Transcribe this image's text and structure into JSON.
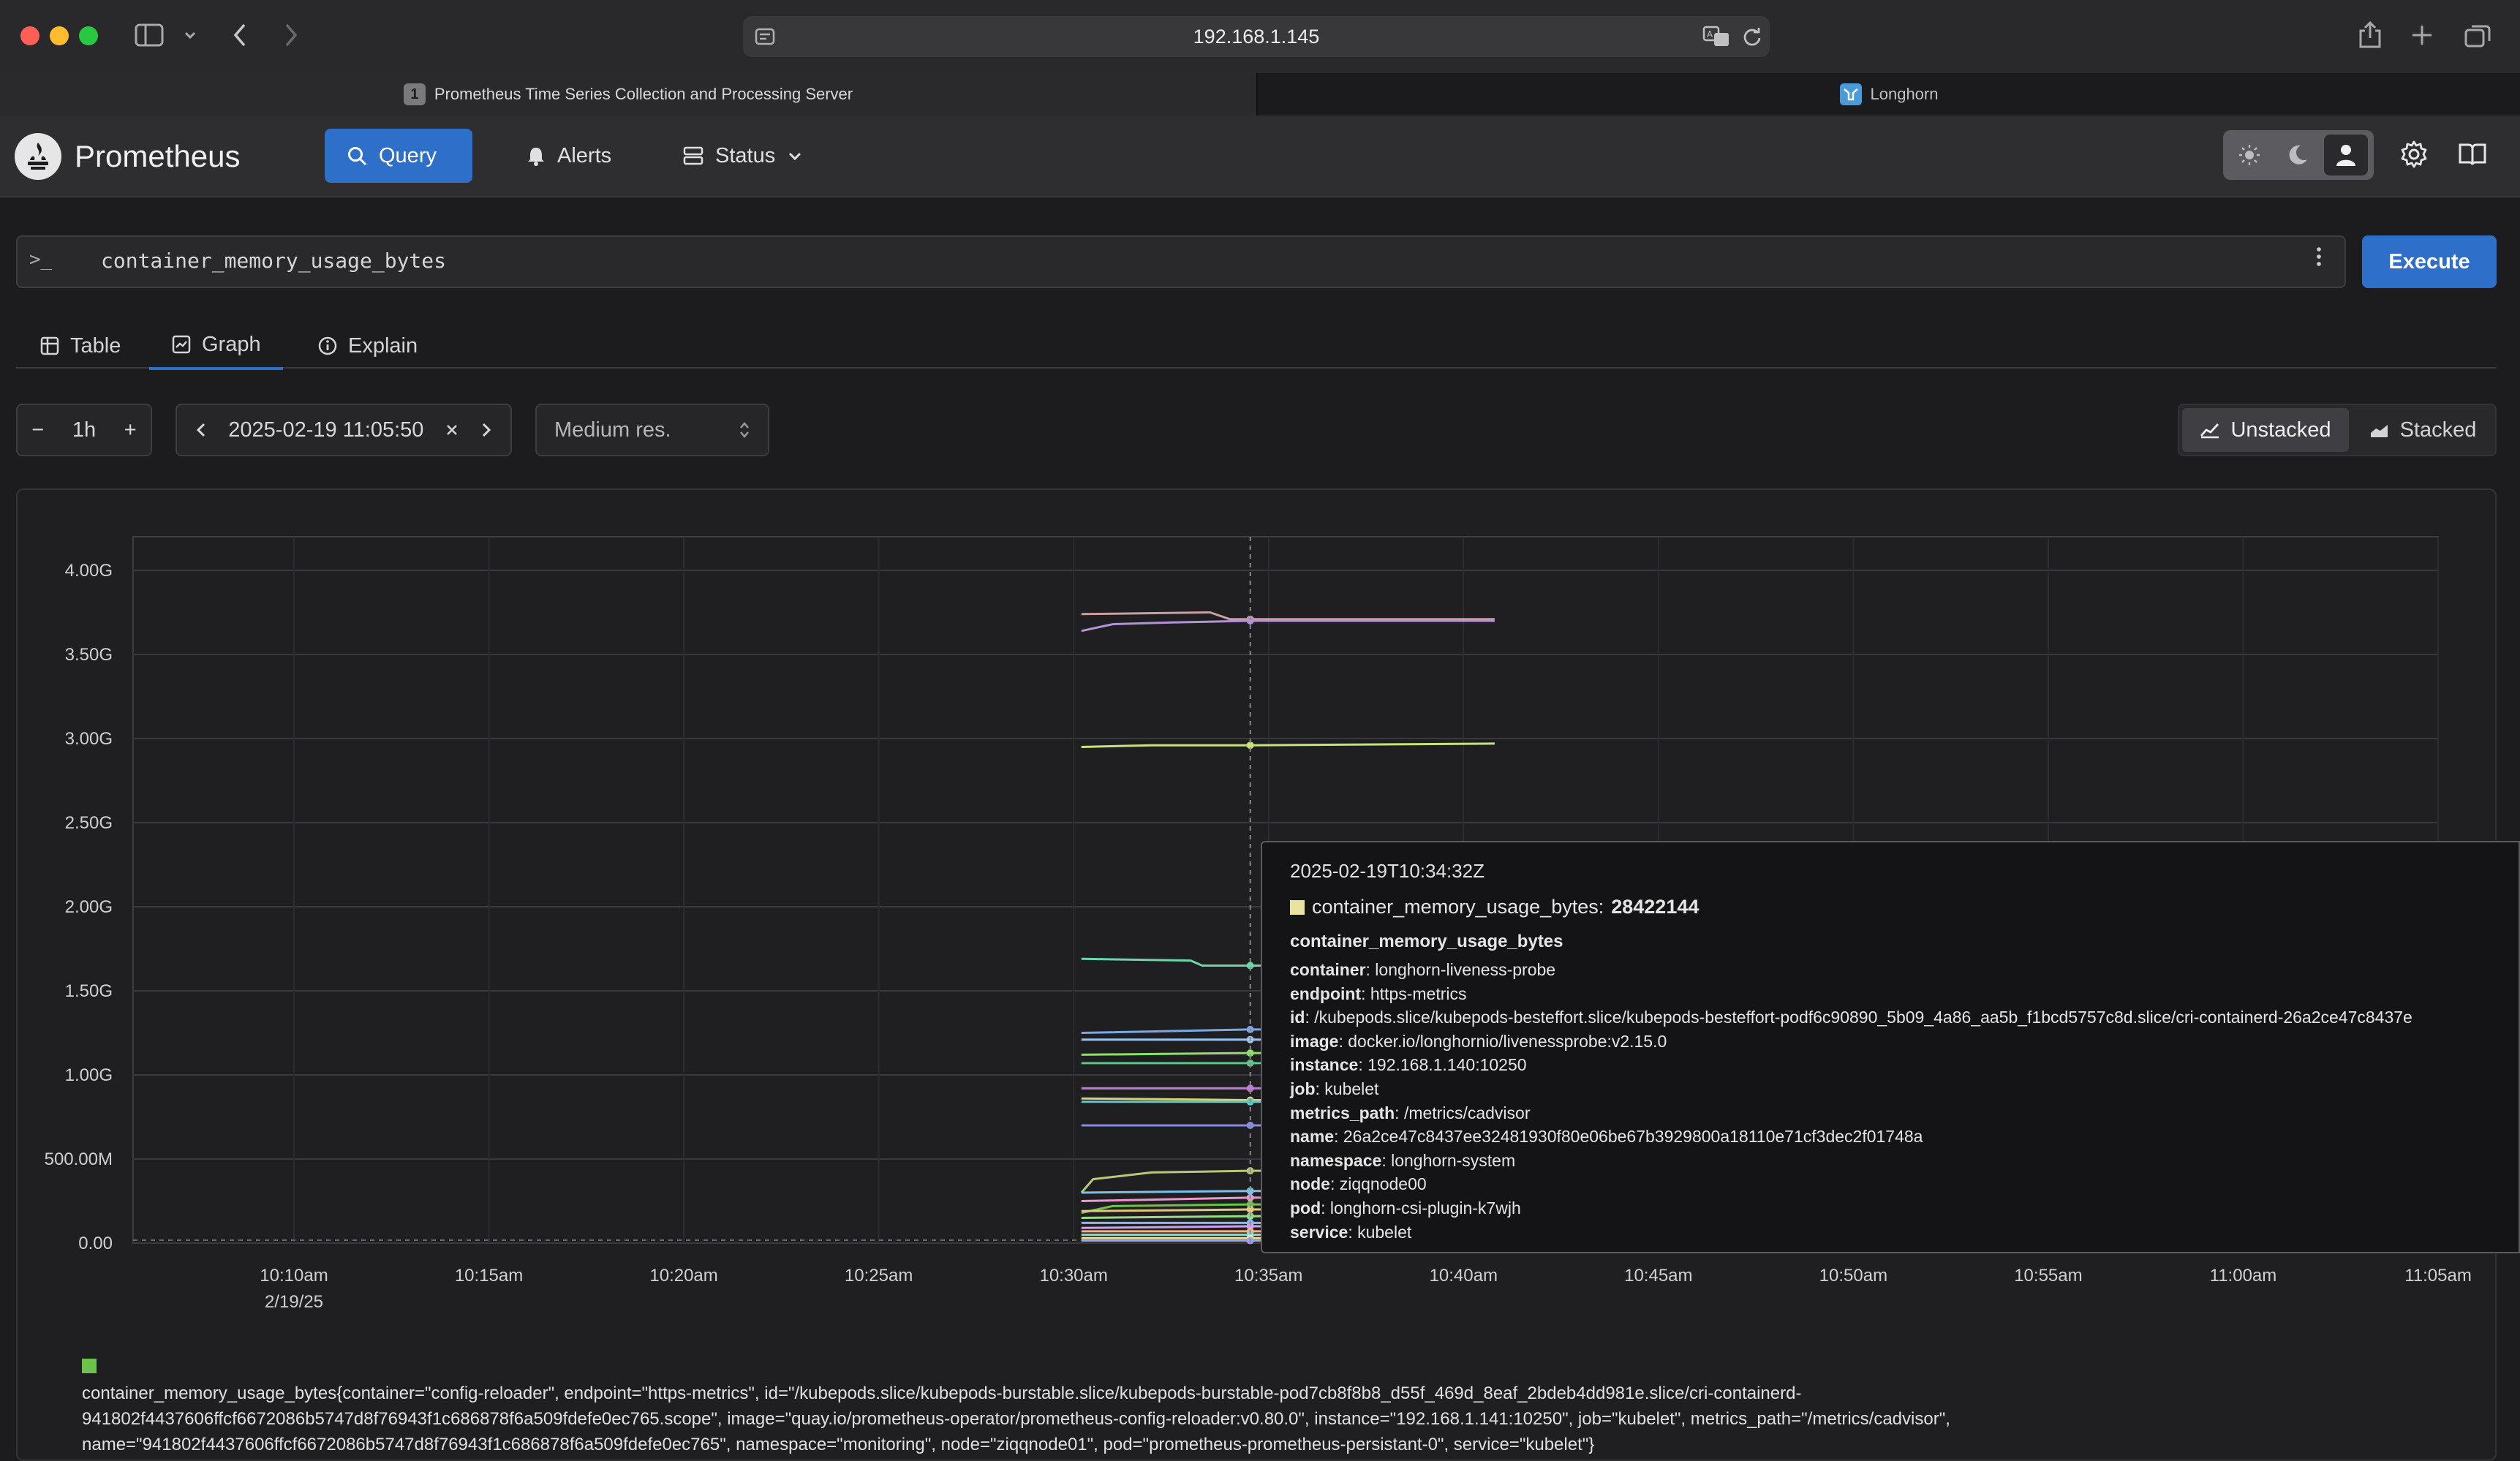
{
  "browser": {
    "url": "192.168.1.145",
    "tabs": [
      {
        "label": "Prometheus Time Series Collection and Processing Server",
        "badge": "1"
      },
      {
        "label": "Longhorn"
      }
    ]
  },
  "navbar": {
    "brand": "Prometheus",
    "items": [
      {
        "label": "Query",
        "icon": "search-icon",
        "active": true
      },
      {
        "label": "Alerts",
        "icon": "bell-icon"
      },
      {
        "label": "Status",
        "icon": "server-icon"
      }
    ],
    "theme_options": [
      "light",
      "dark",
      "auto"
    ],
    "accent": "#2e70c9"
  },
  "query": {
    "prompt": ">_",
    "expression": "container_memory_usage_bytes",
    "execute_label": "Execute"
  },
  "tabs": [
    {
      "label": "Table",
      "icon": "table-icon"
    },
    {
      "label": "Graph",
      "icon": "graph-icon",
      "active": true
    },
    {
      "label": "Explain",
      "icon": "info-icon"
    }
  ],
  "controls": {
    "range": "1h",
    "minus": "−",
    "plus": "+",
    "end_time": "2025-02-19 11:05:50",
    "resolution": "Medium res.",
    "unstacked_label": "Unstacked",
    "stacked_label": "Stacked"
  },
  "chart_data": {
    "type": "line",
    "ylim": [
      0,
      4.2
    ],
    "y_unit": "G",
    "y_ticks": [
      {
        "v": 0,
        "label": "0.00"
      },
      {
        "v": 0.5,
        "label": "500.00M"
      },
      {
        "v": 1.0,
        "label": "1.00G"
      },
      {
        "v": 1.5,
        "label": "1.50G"
      },
      {
        "v": 2.0,
        "label": "2.00G"
      },
      {
        "v": 2.5,
        "label": "2.50G"
      },
      {
        "v": 3.0,
        "label": "3.00G"
      },
      {
        "v": 3.5,
        "label": "3.50G"
      },
      {
        "v": 4.0,
        "label": "4.00G"
      }
    ],
    "x_range_min": [
      6.0,
      66.0
    ],
    "x_ticks": [
      {
        "m": 10,
        "label": "10:10am",
        "sub": "2/19/25"
      },
      {
        "m": 15,
        "label": "10:15am"
      },
      {
        "m": 20,
        "label": "10:20am"
      },
      {
        "m": 25,
        "label": "10:25am"
      },
      {
        "m": 30,
        "label": "10:30am"
      },
      {
        "m": 35,
        "label": "10:35am"
      },
      {
        "m": 40,
        "label": "10:40am"
      },
      {
        "m": 45,
        "label": "10:45am"
      },
      {
        "m": 50,
        "label": "10:50am"
      },
      {
        "m": 55,
        "label": "10:55am"
      },
      {
        "m": 60,
        "label": "11:00am"
      },
      {
        "m": 65,
        "label": "11:05am"
      }
    ],
    "hover_minute": 34.53,
    "series": [
      {
        "color": "#c9a0a0",
        "x": [
          30.2,
          33.5,
          34.0,
          34.5,
          40.8
        ],
        "y": [
          3.74,
          3.75,
          3.71,
          3.71,
          3.71
        ]
      },
      {
        "color": "#b592d6",
        "x": [
          30.2,
          31.0,
          32.5,
          34.5,
          40.8
        ],
        "y": [
          3.64,
          3.68,
          3.69,
          3.7,
          3.7
        ]
      },
      {
        "color": "#c6e27a",
        "x": [
          30.2,
          32.0,
          34.5,
          40.8
        ],
        "y": [
          2.95,
          2.96,
          2.96,
          2.97
        ]
      },
      {
        "color": "#6cd6a8",
        "x": [
          30.2,
          33.0,
          33.3,
          34.5,
          35.0
        ],
        "y": [
          1.69,
          1.68,
          1.65,
          1.65,
          1.65
        ]
      },
      {
        "color": "#7aa8e6",
        "x": [
          30.2,
          34.5,
          35.0
        ],
        "y": [
          1.25,
          1.27,
          1.27
        ]
      },
      {
        "color": "#a0c4f0",
        "x": [
          30.2,
          34.5,
          35.0
        ],
        "y": [
          1.21,
          1.21,
          1.21
        ]
      },
      {
        "color": "#8ee06a",
        "x": [
          30.2,
          34.5,
          35.0
        ],
        "y": [
          1.12,
          1.13,
          1.13
        ]
      },
      {
        "color": "#62c48a",
        "x": [
          30.2,
          34.5,
          35.0
        ],
        "y": [
          1.07,
          1.07,
          1.07
        ]
      },
      {
        "color": "#c27ad8",
        "x": [
          30.2,
          34.5,
          35.0
        ],
        "y": [
          0.92,
          0.92,
          0.92
        ]
      },
      {
        "color": "#d2d27a",
        "x": [
          30.2,
          34.5,
          35.0
        ],
        "y": [
          0.86,
          0.85,
          0.85
        ]
      },
      {
        "color": "#5ec8c8",
        "x": [
          30.2,
          34.5,
          35.0
        ],
        "y": [
          0.84,
          0.84,
          0.84
        ]
      },
      {
        "color": "#8a8ae8",
        "x": [
          30.2,
          34.5,
          35.0
        ],
        "y": [
          0.7,
          0.7,
          0.7
        ]
      },
      {
        "color": "#b8c87a",
        "x": [
          30.2,
          30.5,
          32.0,
          34.5,
          35.0
        ],
        "y": [
          0.3,
          0.38,
          0.42,
          0.43,
          0.43
        ]
      },
      {
        "color": "#7ac0e8",
        "x": [
          30.2,
          34.5,
          35.0
        ],
        "y": [
          0.3,
          0.31,
          0.31
        ]
      },
      {
        "color": "#e89ad0",
        "x": [
          30.2,
          34.5,
          35.0
        ],
        "y": [
          0.25,
          0.27,
          0.27
        ]
      },
      {
        "color": "#6cc24a",
        "x": [
          30.2,
          31.0,
          34.5,
          35.0
        ],
        "y": [
          0.18,
          0.22,
          0.23,
          0.23
        ]
      },
      {
        "color": "#e0c87a",
        "x": [
          30.2,
          34.5,
          35.0
        ],
        "y": [
          0.19,
          0.2,
          0.2
        ]
      },
      {
        "color": "#9ad88a",
        "x": [
          30.2,
          34.5,
          35.0
        ],
        "y": [
          0.15,
          0.16,
          0.16
        ]
      },
      {
        "color": "#8ab8f0",
        "x": [
          30.2,
          34.5,
          35.0
        ],
        "y": [
          0.12,
          0.12,
          0.12
        ]
      },
      {
        "color": "#d0a0f0",
        "x": [
          30.2,
          34.5,
          35.0
        ],
        "y": [
          0.09,
          0.1,
          0.1
        ]
      },
      {
        "color": "#f0b080",
        "x": [
          30.2,
          34.5,
          35.0
        ],
        "y": [
          0.07,
          0.07,
          0.07
        ]
      },
      {
        "color": "#80e0d0",
        "x": [
          30.2,
          34.5,
          35.0
        ],
        "y": [
          0.05,
          0.05,
          0.05
        ]
      },
      {
        "color": "#e8e4a0",
        "x": [
          30.2,
          34.5,
          35.0
        ],
        "y": [
          0.03,
          0.03,
          0.03
        ]
      },
      {
        "color": "#a0a0f0",
        "x": [
          30.2,
          34.5,
          35.0
        ],
        "y": [
          0.015,
          0.015,
          0.015
        ]
      }
    ]
  },
  "tooltip": {
    "timestamp": "2025-02-19T10:34:32Z",
    "metric_label": "container_memory_usage_bytes:",
    "value": "28422144",
    "swatch_color": "#e8e4a0",
    "metric_name": "container_memory_usage_bytes",
    "labels": [
      {
        "k": "container",
        "v": "longhorn-liveness-probe"
      },
      {
        "k": "endpoint",
        "v": "https-metrics"
      },
      {
        "k": "id",
        "v": "/kubepods.slice/kubepods-besteffort.slice/kubepods-besteffort-podf6c90890_5b09_4a86_aa5b_f1bcd5757c8d.slice/cri-containerd-26a2ce47c8437e"
      },
      {
        "k": "image",
        "v": "docker.io/longhornio/livenessprobe:v2.15.0"
      },
      {
        "k": "instance",
        "v": "192.168.1.140:10250"
      },
      {
        "k": "job",
        "v": "kubelet"
      },
      {
        "k": "metrics_path",
        "v": "/metrics/cadvisor"
      },
      {
        "k": "name",
        "v": "26a2ce47c8437ee32481930f80e06be67b3929800a18110e71cf3dec2f01748a"
      },
      {
        "k": "namespace",
        "v": "longhorn-system"
      },
      {
        "k": "node",
        "v": "ziqqnode00"
      },
      {
        "k": "pod",
        "v": "longhorn-csi-plugin-k7wjh"
      },
      {
        "k": "service",
        "v": "kubelet"
      }
    ]
  },
  "legend": {
    "swatch_color": "#6cc24a",
    "text": "container_memory_usage_bytes{container=\"config-reloader\", endpoint=\"https-metrics\", id=\"/kubepods.slice/kubepods-burstable.slice/kubepods-burstable-pod7cb8f8b8_d55f_469d_8eaf_2bdeb4dd981e.slice/cri-containerd-941802f4437606ffcf6672086b5747d8f76943f1c686878f6a509fdefe0ec765.scope\", image=\"quay.io/prometheus-operator/prometheus-config-reloader:v0.80.0\", instance=\"192.168.1.141:10250\", job=\"kubelet\", metrics_path=\"/metrics/cadvisor\", name=\"941802f4437606ffcf6672086b5747d8f76943f1c686878f6a509fdefe0ec765\", namespace=\"monitoring\", node=\"ziqqnode01\", pod=\"prometheus-prometheus-persistant-0\", service=\"kubelet\"}"
  }
}
